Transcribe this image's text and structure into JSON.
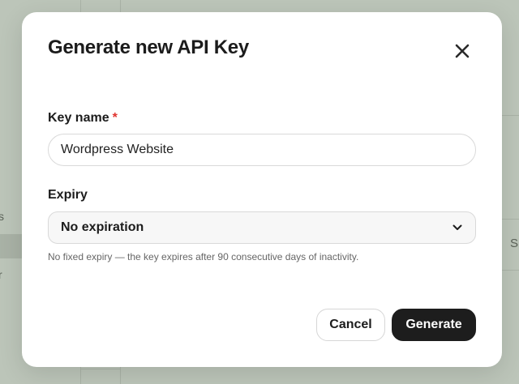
{
  "background": {
    "sidebar_items": [
      "s",
      "r"
    ],
    "right_column_text": "S"
  },
  "modal": {
    "title": "Generate new API Key",
    "close_icon": "close-icon",
    "key_name": {
      "label": "Key name",
      "required_mark": "*",
      "value": "Wordpress Website"
    },
    "expiry": {
      "label": "Expiry",
      "selected": "No expiration",
      "icon": "chevron-down-icon",
      "help_text": "No fixed expiry — the key expires after 90 consecutive days of inactivity."
    },
    "buttons": {
      "cancel": "Cancel",
      "generate": "Generate"
    }
  },
  "colors": {
    "overlay": "#bcc5b9",
    "modal_bg": "#ffffff",
    "required": "#e0342f",
    "primary_button": "#1d1d1d"
  }
}
